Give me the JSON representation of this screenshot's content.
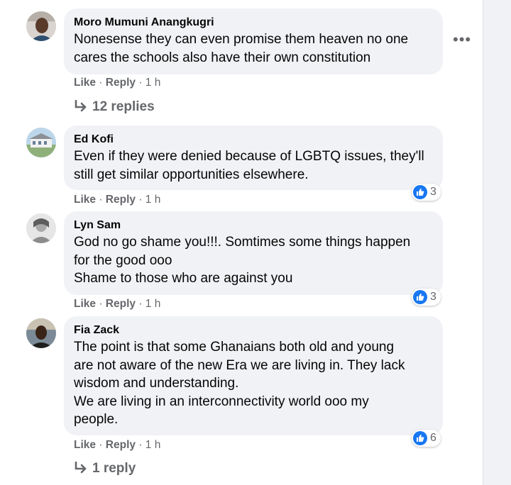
{
  "comments": [
    {
      "author": "Moro Mumuni Anangkugri",
      "lines": [
        "Nonesense they can even promise them heaven no one",
        "cares the schools also have their own constitution"
      ],
      "like_label": "Like",
      "reply_label": "Reply",
      "time": "1 h",
      "replies_label": "12 replies"
    },
    {
      "author": "Ed Kofi",
      "lines": [
        "Even if they were denied because of LGBTQ issues, they'll",
        "still get similar opportunities elsewhere."
      ],
      "like_label": "Like",
      "reply_label": "Reply",
      "time": "1 h",
      "reaction_count": "3"
    },
    {
      "author": "Lyn Sam",
      "lines": [
        "God no go shame you!!!. Somtimes some things happen",
        "for the good ooo",
        "Shame to those who are against you"
      ],
      "like_label": "Like",
      "reply_label": "Reply",
      "time": "1 h",
      "reaction_count": "3"
    },
    {
      "author": "Fia Zack",
      "lines": [
        "The point is that some Ghanaians both old and young",
        "are not aware of the new Era we are living in. They lack",
        "wisdom and understanding.",
        "We are living in an interconnectivity world ooo my",
        "people."
      ],
      "like_label": "Like",
      "reply_label": "Reply",
      "time": "1 h",
      "reaction_count": "6",
      "replies_label": "1 reply"
    }
  ],
  "separator": " · ",
  "more_icon": "more-options-icon",
  "reply_icon": "reply-arrow-icon",
  "like_icon": "thumbs-up-icon",
  "colors": {
    "bubble": "#f0f2f5",
    "secondary_text": "#65676b",
    "like_blue": "#1877f2"
  }
}
